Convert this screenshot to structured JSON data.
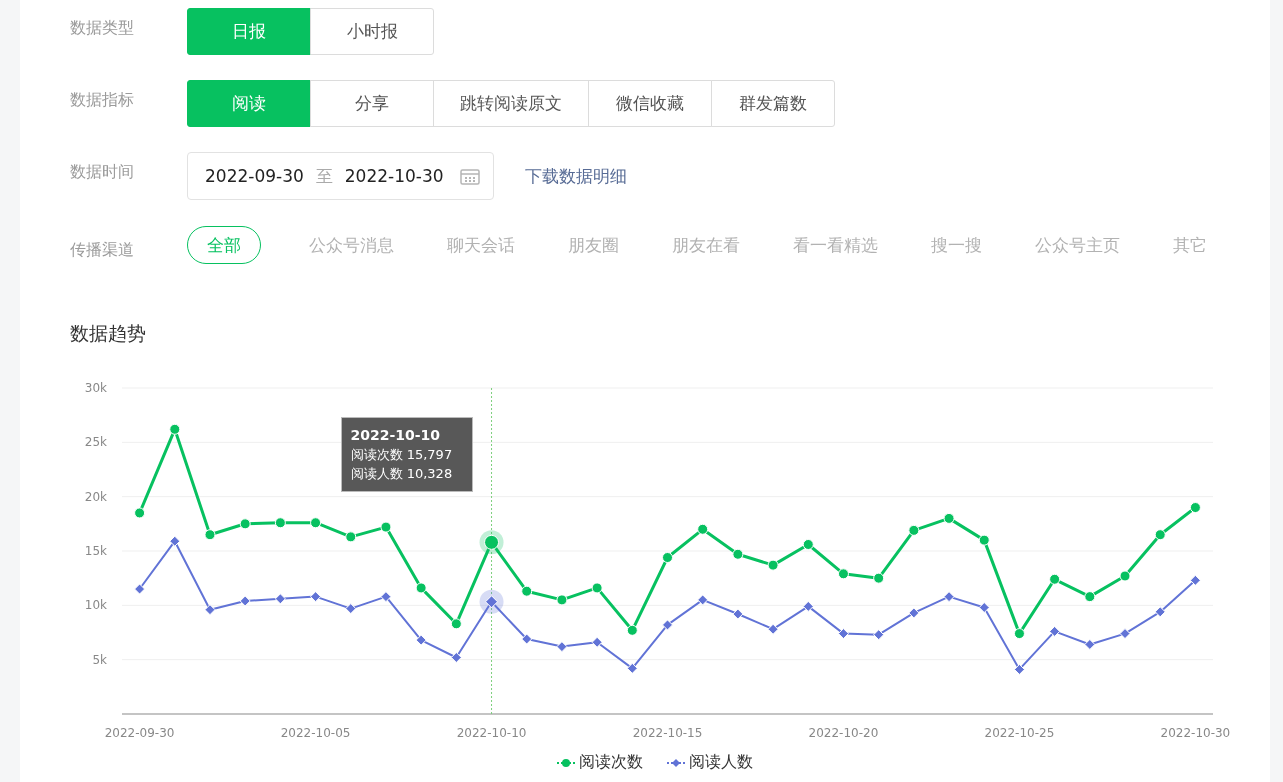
{
  "filters": [
    {
      "label": "数据类型",
      "kind": "segmented",
      "options": [
        {
          "label": "日报",
          "selected": true
        },
        {
          "label": "小时报",
          "selected": false
        }
      ]
    },
    {
      "label": "数据指标",
      "kind": "segmented",
      "options": [
        {
          "label": "阅读",
          "selected": true
        },
        {
          "label": "分享",
          "selected": false
        },
        {
          "label": "跳转阅读原文",
          "selected": false
        },
        {
          "label": "微信收藏",
          "selected": false
        },
        {
          "label": "群发篇数",
          "selected": false
        }
      ]
    },
    {
      "label": "数据时间",
      "kind": "daterange",
      "start": "2022-09-30",
      "separator": "至",
      "end": "2022-10-30",
      "link": "下载数据明细"
    },
    {
      "label": "传播渠道",
      "kind": "pills",
      "options": [
        {
          "label": "全部",
          "selected": true
        },
        {
          "label": "公众号消息",
          "selected": false
        },
        {
          "label": "聊天会话",
          "selected": false
        },
        {
          "label": "朋友圈",
          "selected": false
        },
        {
          "label": "朋友在看",
          "selected": false
        },
        {
          "label": "看一看精选",
          "selected": false
        },
        {
          "label": "搜一搜",
          "selected": false
        },
        {
          "label": "公众号主页",
          "selected": false
        },
        {
          "label": "其它",
          "selected": false
        }
      ]
    }
  ],
  "trend": {
    "title": "数据趋势",
    "chart_data": {
      "type": "line",
      "grid": true,
      "legend": true,
      "categories": [
        "2022-09-30",
        null,
        null,
        null,
        null,
        "2022-10-05",
        null,
        null,
        null,
        null,
        "2022-10-10",
        null,
        null,
        null,
        null,
        "2022-10-15",
        null,
        null,
        null,
        null,
        "2022-10-20",
        null,
        null,
        null,
        null,
        "2022-10-25",
        null,
        null,
        null,
        null,
        "2022-10-30"
      ],
      "series": [
        {
          "name": "阅读次数",
          "color": "#07c160",
          "marker": "circle",
          "values": [
            18500,
            26200,
            16500,
            17500,
            17600,
            17600,
            16300,
            17200,
            11600,
            8300,
            15797,
            11300,
            10500,
            11600,
            7700,
            14400,
            17000,
            14700,
            13700,
            15600,
            12900,
            12500,
            16900,
            18000,
            16000,
            7400,
            12400,
            10800,
            12700,
            16500,
            19000
          ]
        },
        {
          "name": "阅读人数",
          "color": "#6173d6",
          "marker": "diamond",
          "values": [
            11500,
            15900,
            9600,
            10400,
            10600,
            10800,
            9700,
            10800,
            6800,
            5200,
            10328,
            6900,
            6200,
            6600,
            4200,
            8200,
            10500,
            9200,
            7800,
            9900,
            7400,
            7300,
            9300,
            10800,
            9800,
            4100,
            7600,
            6400,
            7400,
            9400,
            12300
          ]
        }
      ],
      "ylim": [
        0,
        30000
      ],
      "yticks": [
        {
          "value": 5000,
          "label": "5k"
        },
        {
          "value": 10000,
          "label": "10k"
        },
        {
          "value": 15000,
          "label": "15k"
        },
        {
          "value": 20000,
          "label": "20k"
        },
        {
          "value": 25000,
          "label": "25k"
        },
        {
          "value": 30000,
          "label": "30k"
        }
      ],
      "ref_lines": [
        {
          "axis": "x",
          "value": "2022-10-10"
        }
      ]
    },
    "tooltip": {
      "date": "2022-10-10",
      "rows": [
        {
          "label": "阅读次数",
          "value": "15,797"
        },
        {
          "label": "阅读人数",
          "value": "10,328"
        }
      ]
    }
  }
}
